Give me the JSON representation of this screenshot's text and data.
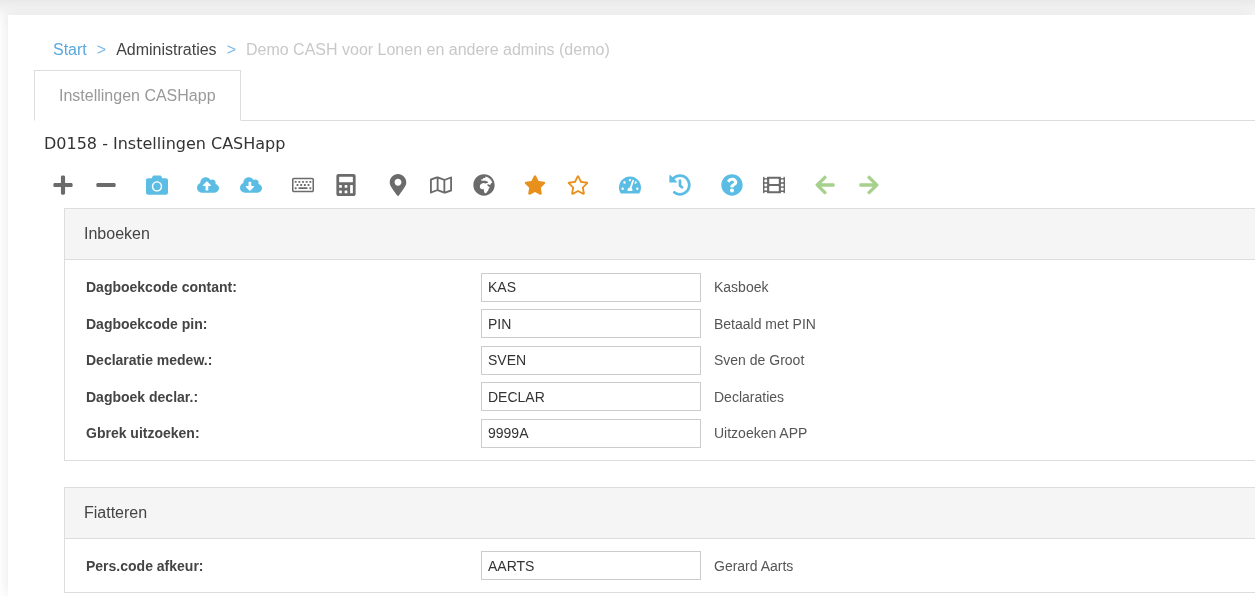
{
  "breadcrumb": {
    "separator": ">",
    "items": [
      {
        "label": "Start",
        "kind": "link"
      },
      {
        "label": "Administraties",
        "kind": "text"
      },
      {
        "label": "Demo CASH voor Lonen en andere admins (demo)",
        "kind": "current"
      }
    ]
  },
  "tabs": [
    {
      "label": "Instellingen CASHapp",
      "selected": true
    }
  ],
  "page_title": "D0158 - Instellingen CASHapp",
  "sections": [
    {
      "title": "Inboeken",
      "fields": [
        {
          "label": "Dagboekcode contant:",
          "value": "KAS",
          "description": "Kasboek"
        },
        {
          "label": "Dagboekcode pin:",
          "value": "PIN",
          "description": "Betaald met PIN"
        },
        {
          "label": "Declaratie medew.:",
          "value": "SVEN",
          "description": "Sven de Groot"
        },
        {
          "label": "Dagboek declar.:",
          "value": "DECLAR",
          "description": "Declaraties"
        },
        {
          "label": "Gbrek uitzoeken:",
          "value": "9999A",
          "description": "Uitzoeken APP"
        }
      ]
    },
    {
      "title": "Fiatteren",
      "fields": [
        {
          "label": "Pers.code afkeur:",
          "value": "AARTS",
          "description": "Gerard Aarts"
        }
      ]
    }
  ]
}
